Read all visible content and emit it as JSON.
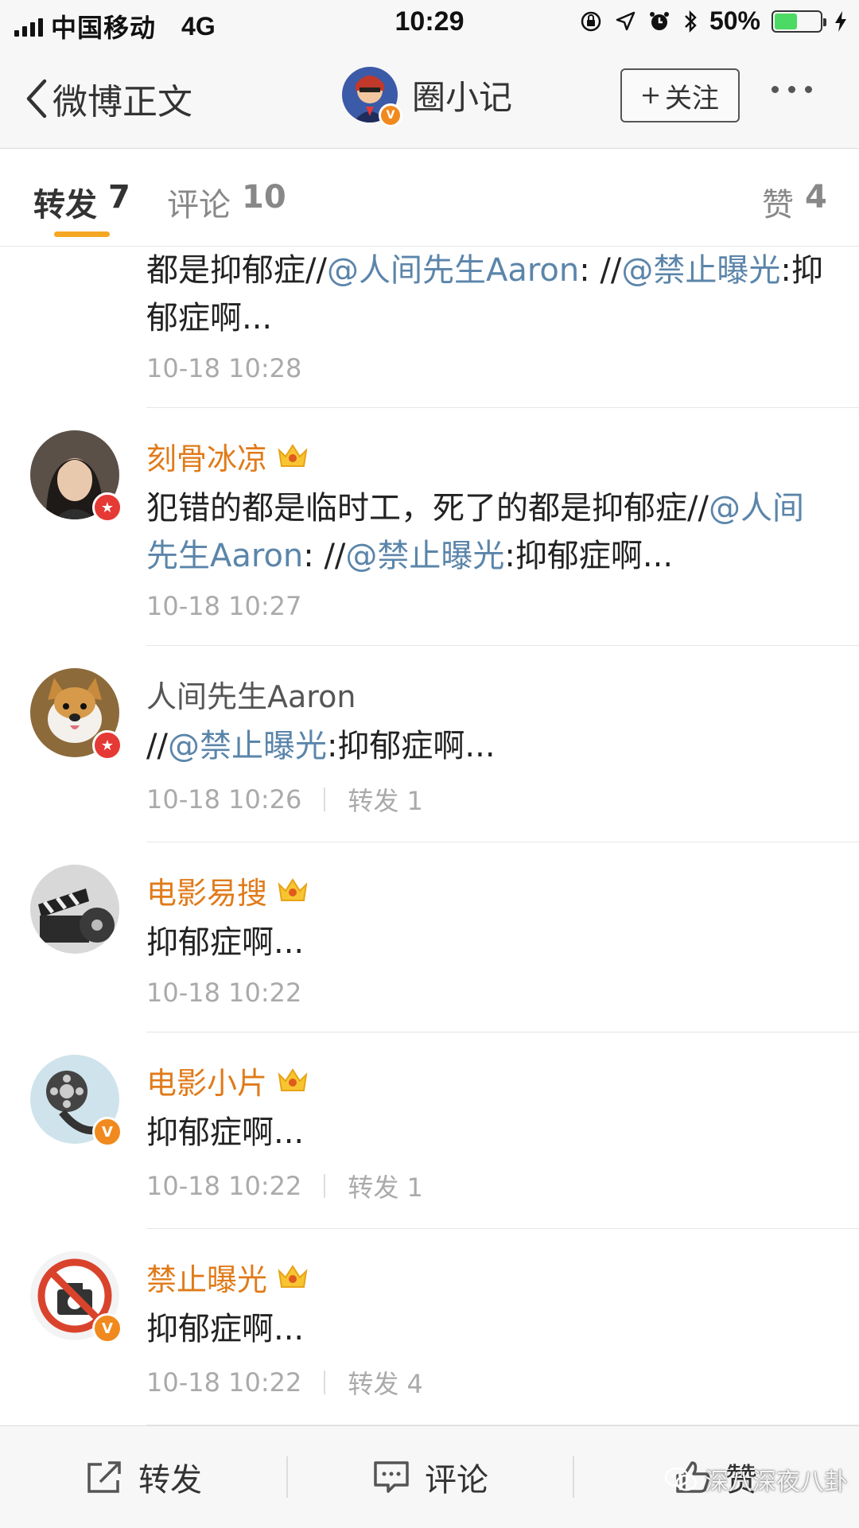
{
  "status_bar": {
    "carrier": "中国移动",
    "network": "4G",
    "time": "10:29",
    "battery_percent_text": "50%",
    "battery_level": 0.5
  },
  "nav": {
    "back_label": "微博正文",
    "account_name": "圈小记",
    "follow_label": "关注"
  },
  "tabs": {
    "repost": {
      "label": "转发",
      "count": "7"
    },
    "comment": {
      "label": "评论",
      "count": "10"
    },
    "like": {
      "label": "赞",
      "count": "4"
    }
  },
  "feed": {
    "items": [
      {
        "name": "",
        "content": [
          {
            "t": "都是抑郁症//",
            "m": false
          },
          {
            "t": "@人间先生Aaron",
            "m": true
          },
          {
            "t": ": //",
            "m": false
          },
          {
            "t": "@禁止曝光",
            "m": true
          },
          {
            "t": ":抑郁症啊...",
            "m": false
          }
        ],
        "time": "10-18 10:28",
        "reposts": ""
      },
      {
        "name": "刻骨冰凉",
        "content": [
          {
            "t": "犯错的都是临时工，死了的都是抑郁症//",
            "m": false
          },
          {
            "t": "@人间先生Aaron",
            "m": true
          },
          {
            "t": ": //",
            "m": false
          },
          {
            "t": "@禁止曝光",
            "m": true
          },
          {
            "t": ":抑郁症啊...",
            "m": false
          }
        ],
        "time": "10-18 10:27",
        "reposts": ""
      },
      {
        "name": "人间先生Aaron",
        "content": [
          {
            "t": "//",
            "m": false
          },
          {
            "t": "@禁止曝光",
            "m": true
          },
          {
            "t": ":抑郁症啊...",
            "m": false
          }
        ],
        "time": "10-18 10:26",
        "reposts": "转发 1"
      },
      {
        "name": "电影易搜",
        "content": [
          {
            "t": "抑郁症啊...",
            "m": false
          }
        ],
        "time": "10-18 10:22",
        "reposts": ""
      },
      {
        "name": "电影小片",
        "content": [
          {
            "t": "抑郁症啊...",
            "m": false
          }
        ],
        "time": "10-18 10:22",
        "reposts": "转发 1"
      },
      {
        "name": "禁止曝光",
        "content": [
          {
            "t": "抑郁症啊...",
            "m": false
          }
        ],
        "time": "10-18 10:22",
        "reposts": "转发 4"
      }
    ]
  },
  "toolbar": {
    "repost_label": "转发",
    "comment_label": "评论",
    "like_label": "赞"
  },
  "watermark": "深八深夜八卦",
  "colors": {
    "accent": "#f5a623",
    "username": "#e07b1a",
    "mention": "#5b85aa",
    "meta": "#aaaaaa"
  }
}
